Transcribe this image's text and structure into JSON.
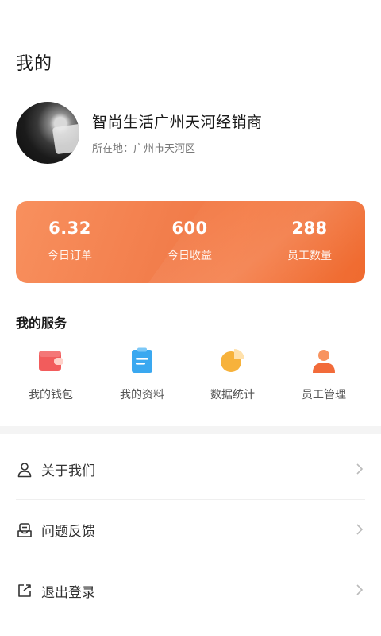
{
  "header": {
    "title": "我的"
  },
  "profile": {
    "shop_name": "智尚生活广州天河经销商",
    "location": "所在地：广州市天河区"
  },
  "stats": [
    {
      "value": "6.32",
      "label": "今日订单"
    },
    {
      "value": "600",
      "label": "今日收益"
    },
    {
      "value": "288",
      "label": "员工数量"
    }
  ],
  "services": {
    "title": "我的服务",
    "items": [
      {
        "label": "我的钱包",
        "icon": "wallet-icon"
      },
      {
        "label": "我的资料",
        "icon": "clipboard-icon"
      },
      {
        "label": "数据统计",
        "icon": "pie-chart-icon"
      },
      {
        "label": "员工管理",
        "icon": "person-icon"
      }
    ]
  },
  "menu": [
    {
      "label": "关于我们",
      "icon": "user-outline-icon"
    },
    {
      "label": "问题反馈",
      "icon": "feedback-icon"
    },
    {
      "label": "退出登录",
      "icon": "logout-icon"
    }
  ],
  "colors": {
    "accent": "#f27d4b",
    "wallet": "#f25c5c",
    "clipboard": "#3aa8f0",
    "pie": "#f7b23b",
    "person": "#f26b3a"
  }
}
